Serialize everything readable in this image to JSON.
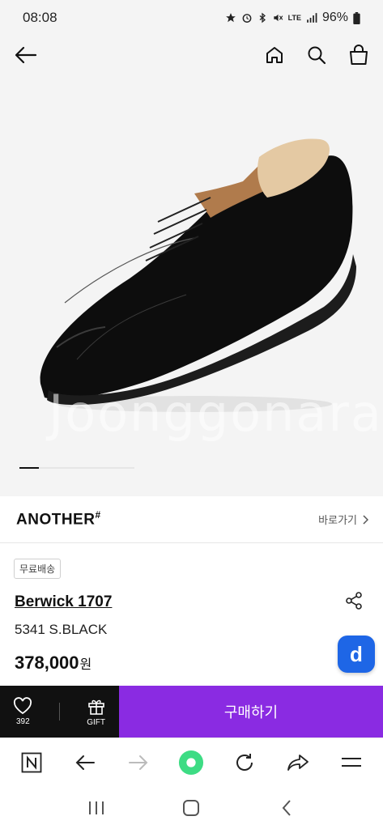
{
  "status": {
    "time": "08:08",
    "battery": "96%",
    "network": "LTE"
  },
  "product_image": {
    "watermark": "Joonggonara",
    "current_slide": 1
  },
  "brand": {
    "name": "ANOTHER",
    "suffix": "#",
    "link_label": "바로가기"
  },
  "product": {
    "tag": "무료배송",
    "title": "Berwick 1707",
    "subtitle": "5341 S.BLACK",
    "price": "378,000",
    "currency": "원",
    "badge": "d"
  },
  "actions": {
    "like_count": "392",
    "gift_label": "GIFT",
    "buy_label": "구매하기"
  },
  "colors": {
    "buy": "#8a2be2",
    "dark": "#111111",
    "badge": "#1e66e6",
    "browser_accent": "#3ddc84"
  },
  "icons": [
    "back-arrow-icon",
    "home-icon",
    "search-icon",
    "cart-icon",
    "share-icon",
    "heart-icon",
    "gift-icon",
    "n-logo-icon",
    "browser-back-icon",
    "browser-forward-icon",
    "green-circle-icon",
    "refresh-icon",
    "share-arrow-icon",
    "menu-icon",
    "recent-apps-icon",
    "home-nav-icon",
    "back-nav-icon"
  ]
}
